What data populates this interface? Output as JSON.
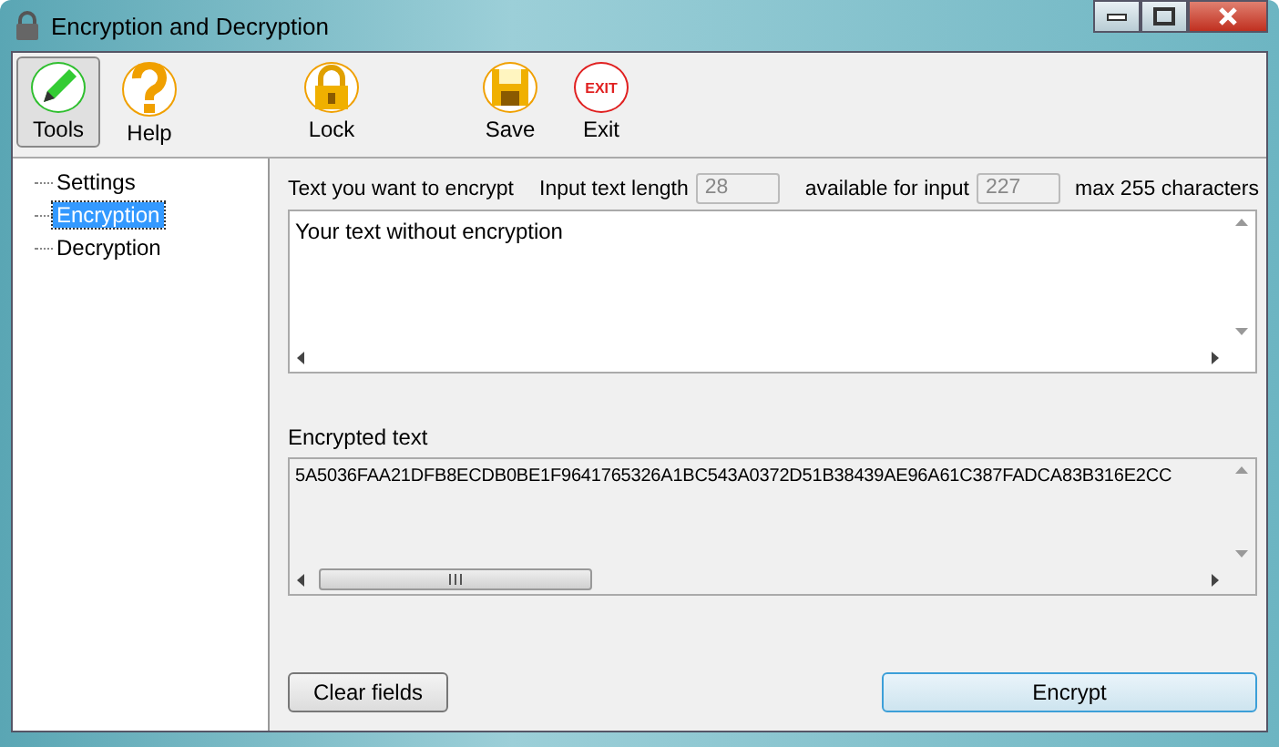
{
  "window": {
    "title": "Encryption and Decryption"
  },
  "toolbar": [
    {
      "label": "Tools",
      "kind": "pencil",
      "selected": true
    },
    {
      "label": "Help",
      "kind": "question",
      "selected": false
    },
    {
      "label": "Lock",
      "kind": "lock",
      "selected": false
    },
    {
      "label": "Save",
      "kind": "disk",
      "selected": false
    },
    {
      "label": "Exit",
      "kind": "exit",
      "icon_text": "EXIT",
      "selected": false
    }
  ],
  "tree": [
    {
      "label": "Settings",
      "selected": false
    },
    {
      "label": "Encryption",
      "selected": true
    },
    {
      "label": "Decryption",
      "selected": false
    }
  ],
  "input": {
    "label": "Text you want to encrypt",
    "length_label": "Input text length",
    "length": "28",
    "available_label": "available for input",
    "available": "227",
    "max_label": "max 255 characters",
    "value": "Your text without encryption"
  },
  "output": {
    "label": "Encrypted text",
    "value": "5A5036FAA21DFB8ECDB0BE1F9641765326A1BC543A0372D51B38439AE96A61C387FADCA83B316E2CC"
  },
  "buttons": [
    {
      "label": "Clear fields",
      "kind": "normal"
    },
    {
      "label": "Encrypt",
      "kind": "default"
    }
  ]
}
